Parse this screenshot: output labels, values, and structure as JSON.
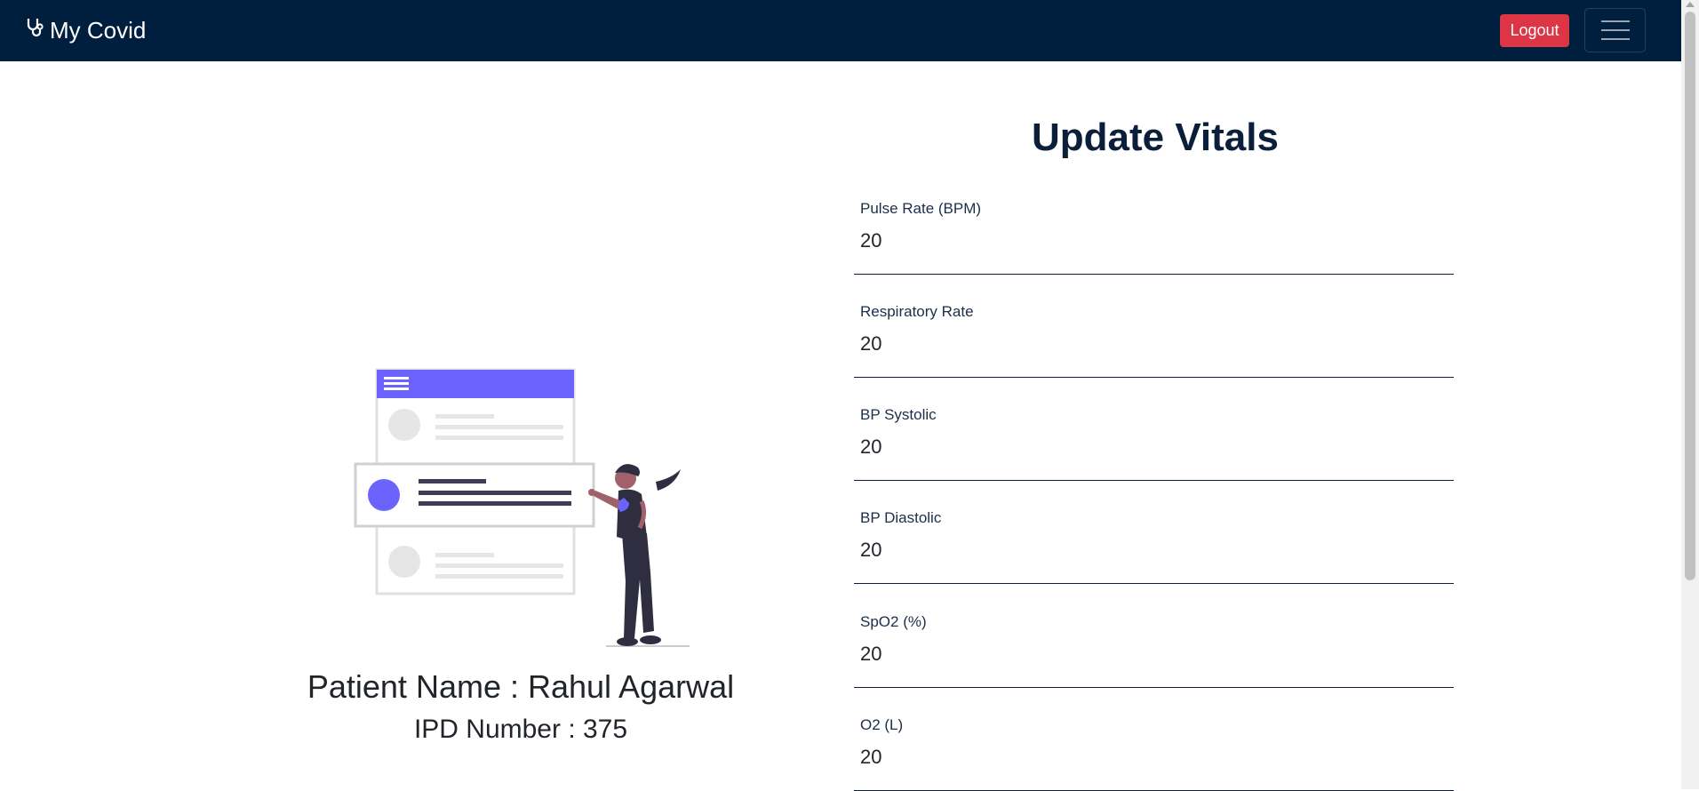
{
  "navbar": {
    "brand": "My Covid",
    "brand_icon": "stethoscope-icon",
    "logout_label": "Logout",
    "toggler_icon": "hamburger-menu-icon",
    "bg_color": "#001f3f"
  },
  "patient": {
    "name_line": "Patient Name : Rahul Agarwal",
    "ipd_line": "IPD Number : 375"
  },
  "form": {
    "title": "Update Vitals",
    "fields": [
      {
        "label": "Pulse Rate (BPM)",
        "value": "20"
      },
      {
        "label": "Respiratory Rate",
        "value": "20"
      },
      {
        "label": "BP Systolic",
        "value": "20"
      },
      {
        "label": "BP Diastolic",
        "value": "20"
      },
      {
        "label": "SpO2 (%)",
        "value": "20"
      },
      {
        "label": "O2 (L)",
        "value": "20"
      }
    ]
  },
  "colors": {
    "accent": "#6c63ff",
    "danger": "#dc3545",
    "navy": "#001f3f"
  }
}
